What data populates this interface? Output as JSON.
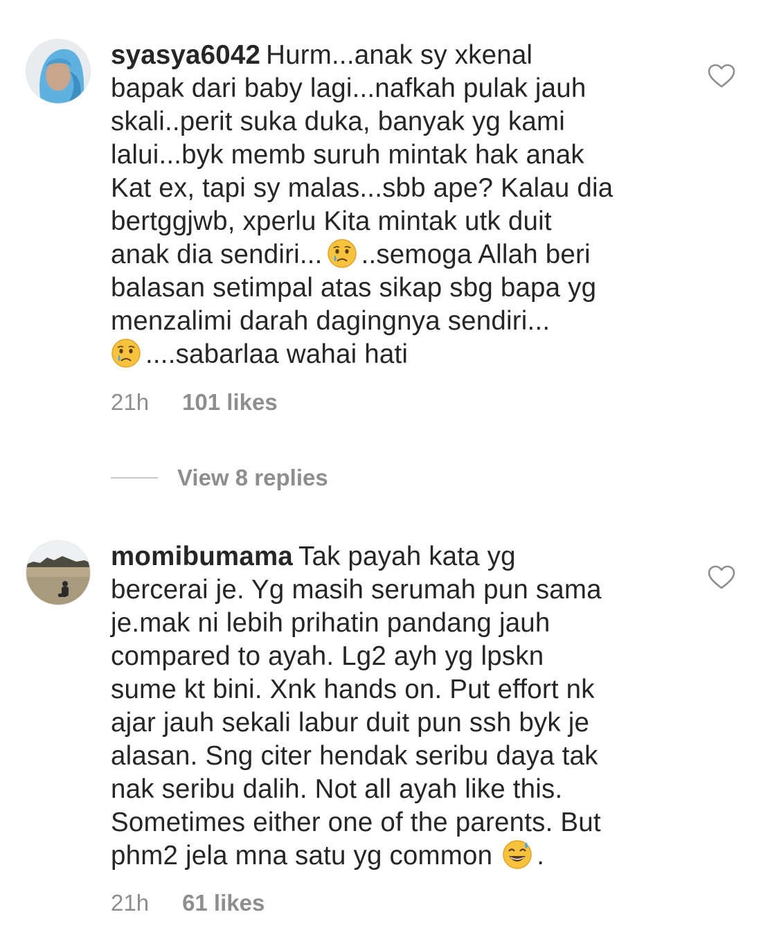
{
  "comments": [
    {
      "username": "syasya6042",
      "lines": [
        "Hurm...anak sy xkenal",
        "bapak dari baby lagi...nafkah pulak jauh",
        "skali..perit suka duka, banyak yg kami",
        "lalui...byk memb suruh mintak hak anak",
        "Kat ex, tapi sy malas...sbb ape? Kalau dia",
        "bertggjwb, xperlu Kita mintak utk duit"
      ],
      "line7_before_emoji": "anak dia sendiri...",
      "line7_after_emoji": "..semoga Allah beri",
      "lines_after": [
        "balasan setimpal atas sikap sbg bapa yg",
        "menzalimi darah dagingnya sendiri..."
      ],
      "last_line_after_emoji": "....sabarlaa wahai hati",
      "emoji_name": "crying-face-emoji",
      "time": "21h",
      "likes": "101 likes",
      "view_replies": "View 8 replies"
    },
    {
      "username": "momibumama",
      "first_line": "Tak payah kata yg",
      "lines": [
        "bercerai je. Yg masih serumah pun sama",
        "je.mak ni lebih prihatin pandang jauh",
        "compared to ayah. Lg2 ayh yg lpskn",
        "sume kt bini. Xnk hands on. Put effort nk",
        "ajar jauh sekali labur duit pun ssh byk je",
        "alasan. Sng citer hendak seribu daya tak",
        "nak seribu dalih. Not all ayah like this.",
        "Sometimes either one of the parents. But"
      ],
      "last_line_before_emoji": "phm2 jela mna satu yg common",
      "last_line_after_emoji": ".",
      "emoji_name": "grinning-sweat-emoji",
      "time": "21h",
      "likes": "61 likes"
    }
  ],
  "icons": {
    "heart": "heart-outline-icon"
  },
  "colors": {
    "text": "#262626",
    "secondary": "#8e8e8e"
  }
}
